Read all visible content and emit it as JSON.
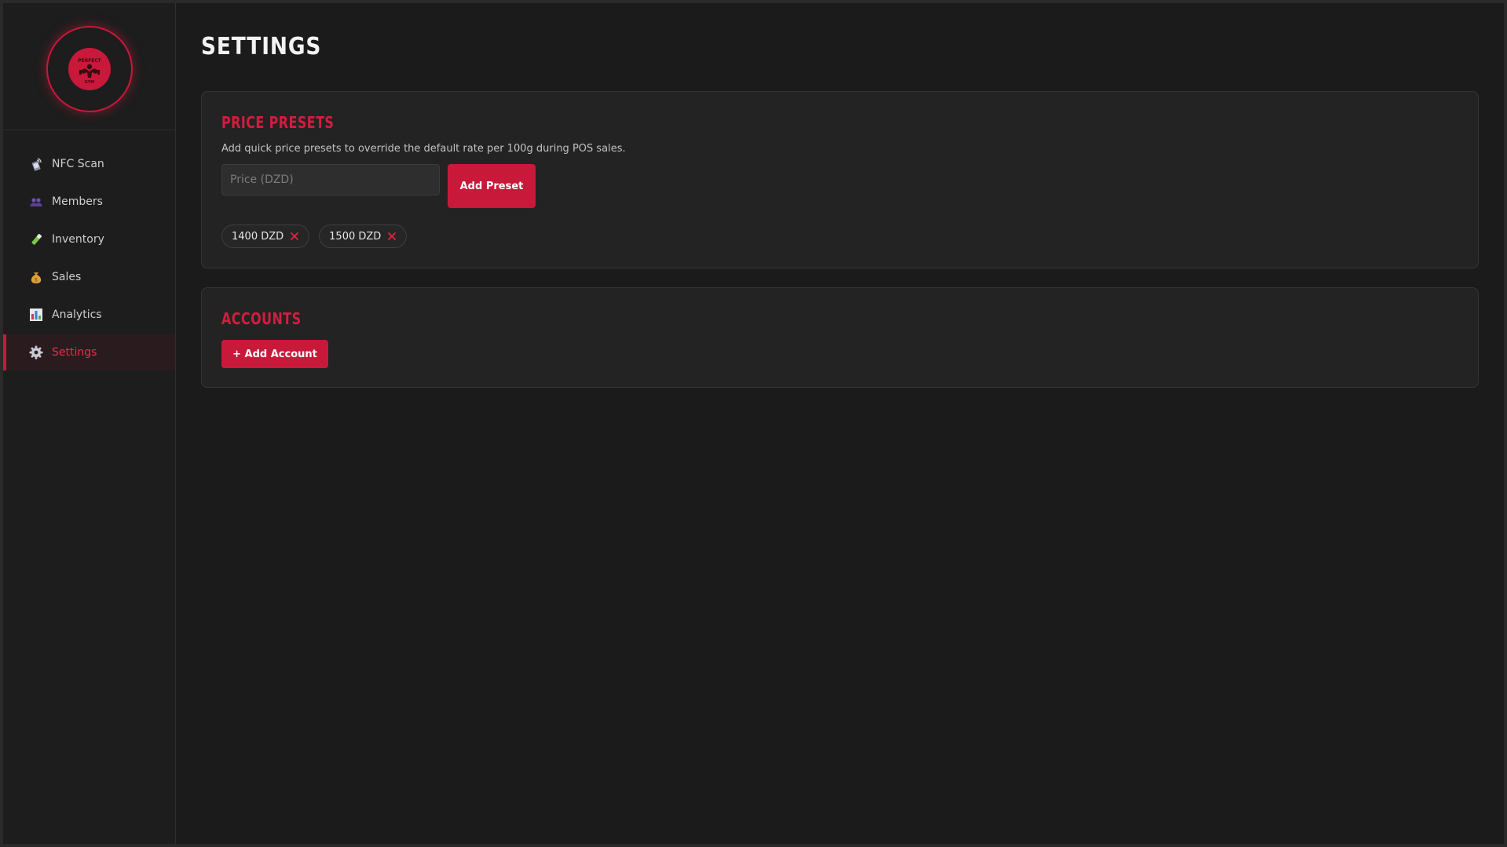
{
  "sidebar": {
    "logo": {
      "top_text": "PERFECT",
      "bottom_text": "GYM"
    },
    "items": [
      {
        "label": "NFC Scan",
        "icon": "nfc-scan-icon"
      },
      {
        "label": "Members",
        "icon": "members-icon"
      },
      {
        "label": "Inventory",
        "icon": "inventory-icon"
      },
      {
        "label": "Sales",
        "icon": "money-bag-icon"
      },
      {
        "label": "Analytics",
        "icon": "bar-chart-icon"
      },
      {
        "label": "Settings",
        "icon": "gear-icon",
        "active": true
      }
    ]
  },
  "page": {
    "title": "SETTINGS"
  },
  "price_presets": {
    "title": "PRICE PRESETS",
    "description": "Add quick price presets to override the default rate per 100g during POS sales.",
    "input_placeholder": "Price (DZD)",
    "input_value": "",
    "add_button": "Add Preset",
    "presets": [
      "1400 DZD",
      "1500 DZD"
    ]
  },
  "accounts": {
    "title": "ACCOUNTS",
    "add_button": "+ Add Account"
  },
  "colors": {
    "accent": "#c8193a",
    "background": "#1b1b1b",
    "card": "#232323"
  }
}
